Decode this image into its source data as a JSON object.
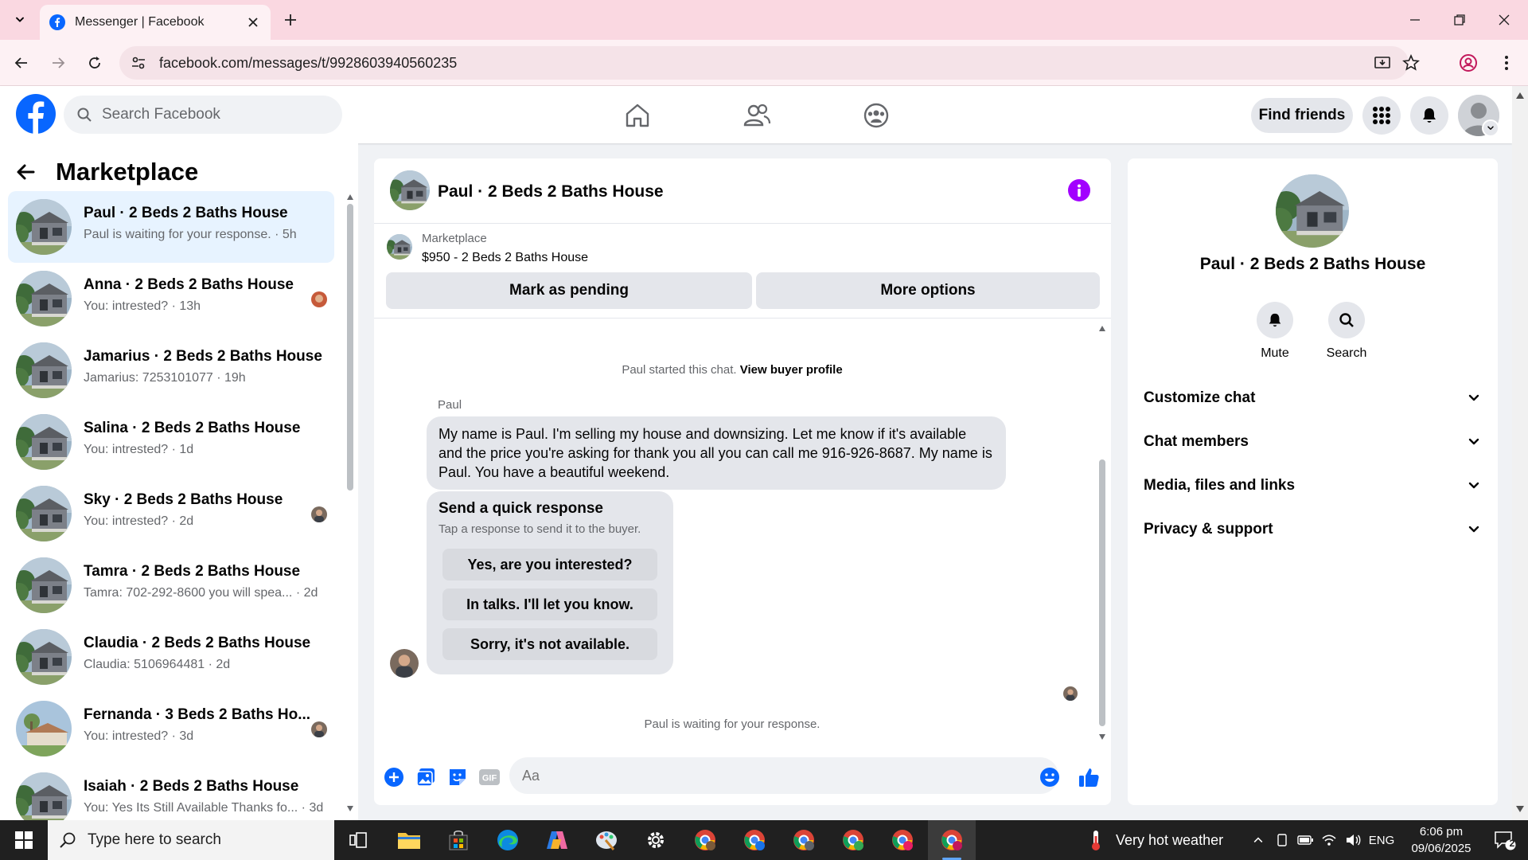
{
  "browser": {
    "tab_title": "Messenger | Facebook",
    "url": "facebook.com/messages/t/9928603940560235"
  },
  "header": {
    "search_placeholder": "Search Facebook",
    "find_friends": "Find friends"
  },
  "left": {
    "title": "Marketplace",
    "conversations": [
      {
        "name": "Paul · 2 Beds 2 Baths House",
        "preview": "Paul is waiting for your response. · 5h",
        "active": true,
        "seen": false
      },
      {
        "name": "Anna · 2 Beds 2 Baths House",
        "preview": "You: intrested? · 13h",
        "active": false,
        "seen": true
      },
      {
        "name": "Jamarius · 2 Beds 2 Baths House",
        "preview": "Jamarius: 7253101077 · 19h",
        "active": false,
        "seen": false
      },
      {
        "name": "Salina · 2 Beds 2 Baths House",
        "preview": "You: intrested? · 1d",
        "active": false,
        "seen": false
      },
      {
        "name": "Sky · 2 Beds 2 Baths House",
        "preview": "You: intrested? · 2d",
        "active": false,
        "seen": true
      },
      {
        "name": "Tamra · 2 Beds 2 Baths House",
        "preview": "Tamra: 702-292-8600 you will spea... · 2d",
        "active": false,
        "seen": false
      },
      {
        "name": "Claudia · 2 Beds 2 Baths House",
        "preview": "Claudia: 5106964481 · 2d",
        "active": false,
        "seen": false
      },
      {
        "name": "Fernanda · 3 Beds 2 Baths Ho...",
        "preview": "You: intrested? · 3d",
        "active": false,
        "seen": true
      },
      {
        "name": "Isaiah · 2 Beds 2 Baths House",
        "preview": "You: Yes Its Still Available Thanks fo... · 3d",
        "active": false,
        "seen": false
      }
    ]
  },
  "chat": {
    "title": "Paul · 2 Beds 2 Baths House",
    "listing_label": "Marketplace",
    "listing_price": "$950 - 2 Beds 2 Baths House",
    "mark_pending": "Mark as pending",
    "more_options": "More options",
    "started_text": "Paul started this chat.",
    "view_profile": "View buyer profile",
    "sender": "Paul",
    "message": "My name is Paul. I'm selling my house and downsizing. Let me know if it's available and the price you're asking for thank you all you can call me 916-926-8687. My name is Paul. You have a beautiful weekend.",
    "quick_title": "Send a quick response",
    "quick_sub": "Tap a response to send it to the buyer.",
    "quick_options": [
      "Yes, are you interested?",
      "In talks. I'll let you know.",
      "Sorry, it's not available."
    ],
    "waiting": "Paul is waiting for your response.",
    "composer_placeholder": "Aa"
  },
  "right": {
    "name": "Paul · 2 Beds 2 Baths House",
    "mute": "Mute",
    "search": "Search",
    "sections": [
      "Customize chat",
      "Chat members",
      "Media, files and links",
      "Privacy & support"
    ]
  },
  "taskbar": {
    "search_placeholder": "Type here to search",
    "weather": "Very hot weather",
    "lang": "ENG",
    "time": "6:06 pm",
    "date": "09/06/2025",
    "notifications": "2"
  },
  "colors": {
    "fb_blue": "#0866ff",
    "info_purple": "#a200ff",
    "active_row": "#e7f3ff",
    "tab_strip": "#fad8e1"
  }
}
